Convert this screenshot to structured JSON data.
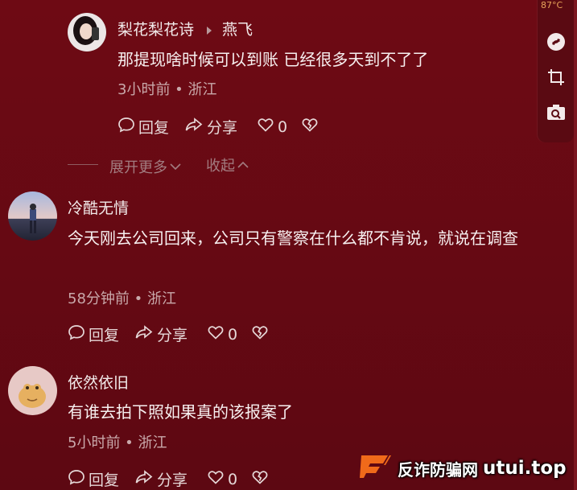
{
  "reply": {
    "author": "梨花梨花诗",
    "reply_to": "燕飞",
    "text": "那提现啥时候可以到账 已经很多天到不了了",
    "meta": "3小时前 • 浙江",
    "actions": {
      "reply": "回复",
      "share": "分享",
      "likes": "0"
    }
  },
  "thread_controls": {
    "expand": "展开更多",
    "collapse": "收起"
  },
  "comments": [
    {
      "author": "冷酷无情",
      "text": "今天刚去公司回来，公司只有警察在什么都不肯说，就说在调查",
      "meta": "58分钟前 • 浙江",
      "actions": {
        "reply": "回复",
        "share": "分享",
        "likes": "0"
      }
    },
    {
      "author": "依然依旧",
      "text": "有谁去拍下照如果真的该报案了",
      "meta": "5小时前 • 浙江",
      "actions": {
        "reply": "回复",
        "share": "分享",
        "likes": "0"
      }
    }
  ],
  "sidebar": {
    "temperature": "87°C",
    "icons": [
      "app-logo-icon",
      "crop-icon",
      "image-search-icon"
    ]
  },
  "watermark": {
    "label": "反诈防骗网",
    "site": "utui.top"
  },
  "colors": {
    "background": "#6b0a14",
    "text": "#f4ecec",
    "muted": "#c9a9ab"
  }
}
